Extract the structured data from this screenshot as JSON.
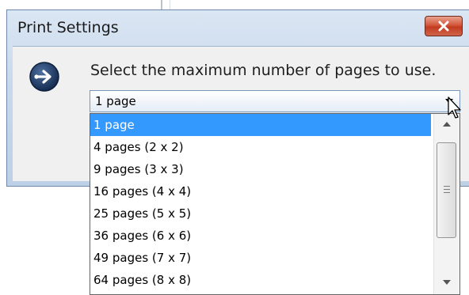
{
  "dialog": {
    "title": "Print Settings",
    "close_icon": "close-icon",
    "prompt": "Select the maximum number of pages to use.",
    "info_icon": "arrow-right-circle-icon"
  },
  "combo": {
    "selected": "1 page"
  },
  "dropdown": {
    "items": [
      {
        "label": "1 page",
        "selected": true
      },
      {
        "label": "4 pages (2 x 2)"
      },
      {
        "label": "9 pages (3 x 3)"
      },
      {
        "label": "16 pages (4 x 4)"
      },
      {
        "label": "25 pages (5 x 5)"
      },
      {
        "label": "36 pages (6 x 6)"
      },
      {
        "label": "49 pages (7 x 7)"
      },
      {
        "label": "64 pages (8 x 8)"
      }
    ]
  },
  "colors": {
    "selection": "#3399ff",
    "close_button": "#c23b1f"
  }
}
